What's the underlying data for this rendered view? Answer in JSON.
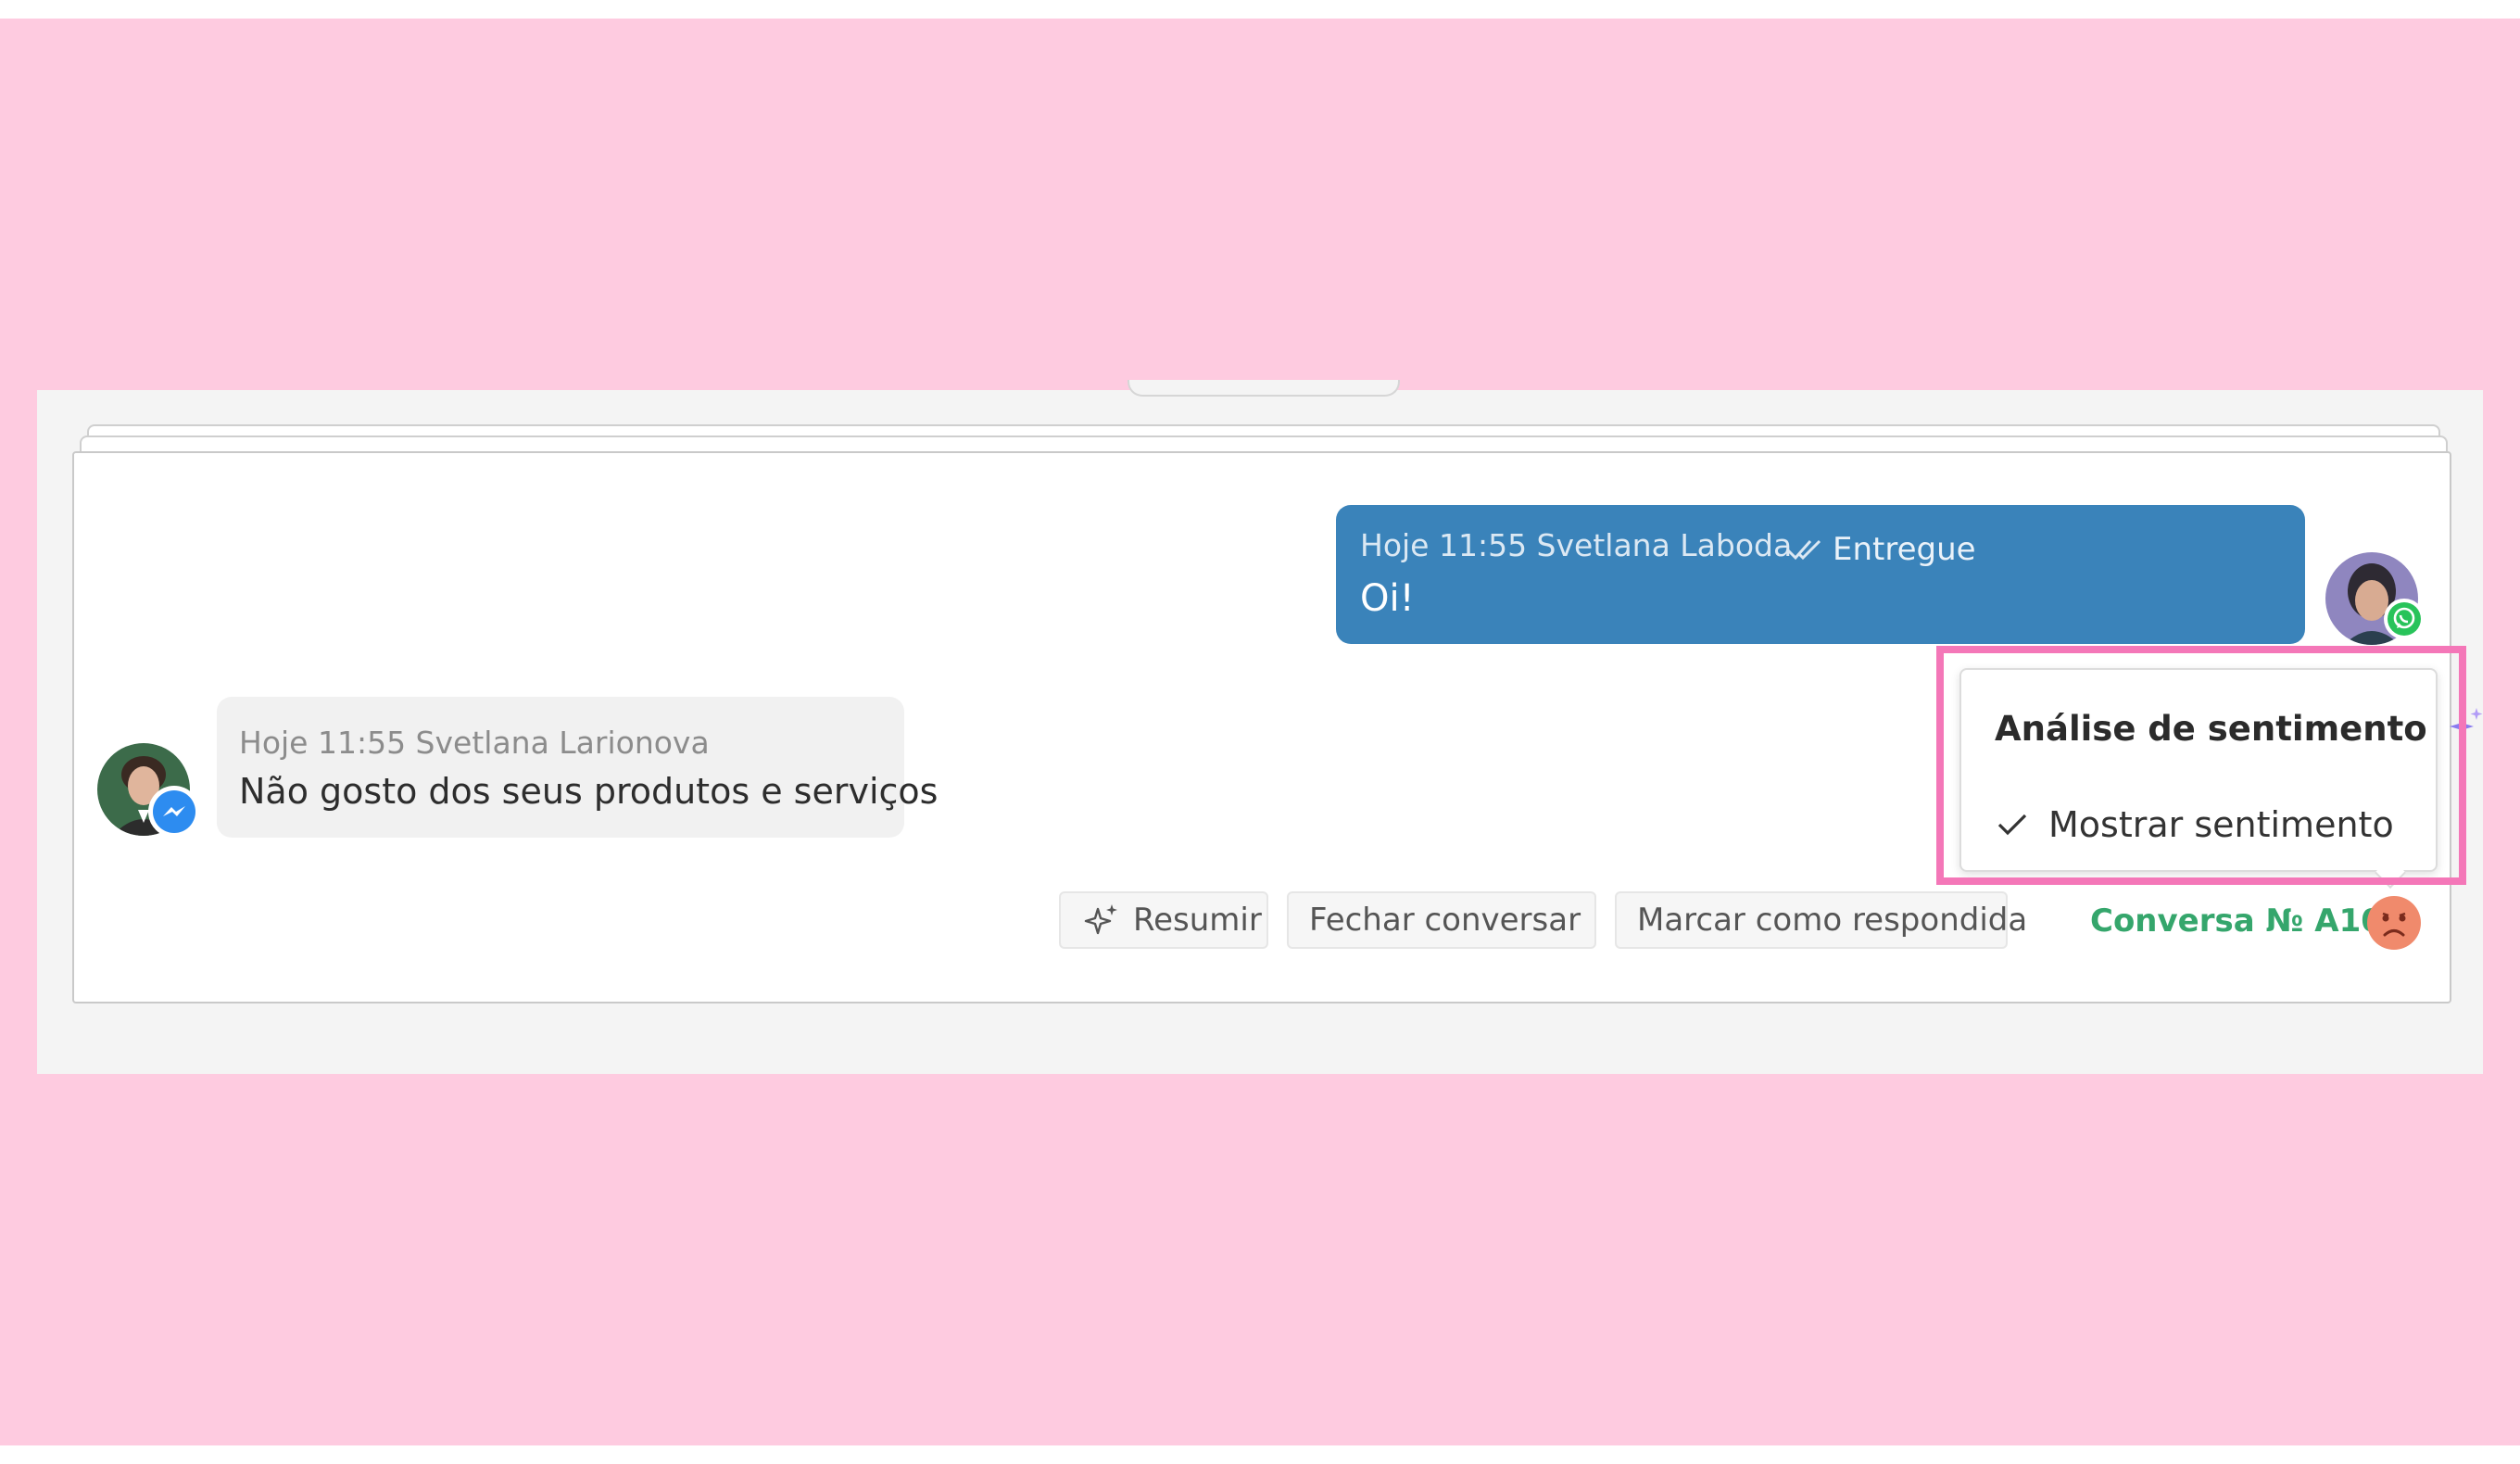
{
  "outgoing_message": {
    "meta": "Hoje 11:55 Svetlana Laboda",
    "status": "Entregue",
    "text": "Oi!",
    "channel_icon": "whatsapp-icon"
  },
  "incoming_message": {
    "meta": "Hoje 11:55 Svetlana Larionova",
    "text": "Não gosto dos seus produtos e serviços",
    "channel_icon": "messenger-icon"
  },
  "actions": {
    "summarize_label": "Resumir",
    "close_label": "Fechar conversar",
    "mark_answered_label": "Marcar como respondida"
  },
  "conversation": {
    "label": "Conversa № A100",
    "sentiment_icon": "sad-face-icon"
  },
  "sentiment_popover": {
    "title": "Análise de sentimento",
    "option_label": "Mostrar sentimento",
    "option_checked": true
  },
  "colors": {
    "background": "#fecbe0",
    "outgoing_bubble": "#3a83ba",
    "incoming_bubble": "#f1f1f1",
    "conversation_label": "#35a66c",
    "sentiment_negative": "#f08a6c",
    "highlight": "#f477b8",
    "sparkle": "#8a7bf0"
  }
}
